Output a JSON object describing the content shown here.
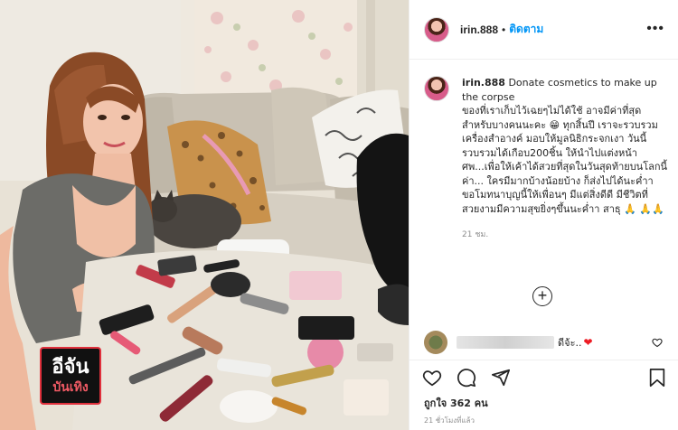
{
  "post": {
    "username": "irin.888",
    "separator": "•",
    "follow_label": "ติดตาม",
    "more_icon": "more-horizontal-icon",
    "caption_title": "Donate cosmetics to make up the corpse",
    "caption_text": "ของที่เราเก็บไว้เฉยๆไม่ได้ใช้ อาจมีค่าที่สุดสำหรับบางคนนะคะ 😁 ทุกสิ้นปี เราจะรวบรวมเครื่องสำอางค์ มอบให้มูลนิธิกระจกเงา วันนี้รวบรวมได้เกือบ200ชิ้น ให้นำไปแต่งหน้าศพ...เพื่อให้เค้าได้สวยที่สุดในวันสุดท้ายบนโลกนี้ค่า... ใครมีมากบ้างน้อยบ้าง ก็ส่งไปได้นะค่ำา ขอโมทนาบุญนี้ให้เพื่อนๆ มีแต่สิ่งดีดี มีชีวิตที่สวยงามมีความสุขยิ่งๆขึ้นนะค่ำา สาธุ 🙏 🙏🙏",
    "caption_time": "21 ชม.",
    "add_comment_icon": "add-circle-icon"
  },
  "comment": {
    "text": "ดีจ้ะ..",
    "emoji": "❤",
    "like_icon": "heart-outline-icon"
  },
  "actions": {
    "like_icon": "heart-outline-icon",
    "comment_icon": "comment-icon",
    "share_icon": "share-icon",
    "save_icon": "bookmark-icon",
    "likes_text": "ถูกใจ 362 คน",
    "posted_ago": "21 ชั่วโมงที่แล้ว"
  },
  "watermark": {
    "line1": "อีจัน",
    "line2": "บันเทิง"
  },
  "colors": {
    "accent": "#0095f6",
    "text": "#262626",
    "muted": "#8e8e8e",
    "border": "#efefef"
  }
}
